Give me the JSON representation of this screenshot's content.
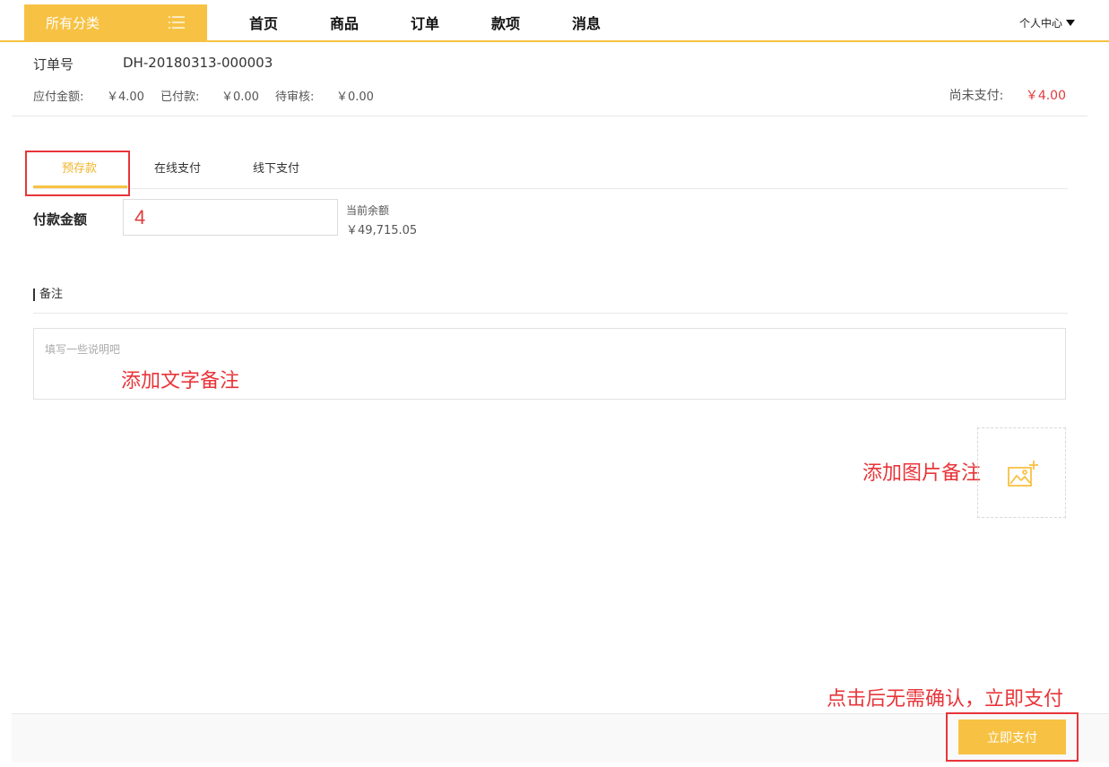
{
  "header": {
    "category_label": "所有分类",
    "nav": [
      "首页",
      "商品",
      "订单",
      "款项",
      "消息"
    ],
    "user_menu": "个人中心"
  },
  "order": {
    "no_label": "订单号",
    "no_value": "DH-20180313-000003",
    "payable_label": "应付金额:",
    "payable_value": "￥4.00",
    "paid_label": "已付款:",
    "paid_value": "￥0.00",
    "pending_label": "待审核:",
    "pending_value": "￥0.00",
    "unpaid_label": "尚未支付:",
    "unpaid_value": "￥4.00"
  },
  "tabs": [
    "预存款",
    "在线支付",
    "线下支付"
  ],
  "active_tab": 0,
  "payment": {
    "amount_label": "付款金额",
    "amount_value": "4",
    "balance_label": "当前余额",
    "balance_value": "￥49,715.05"
  },
  "remark": {
    "title": "备注",
    "placeholder": "填写一些说明吧"
  },
  "annotations": {
    "text_remark": "添加文字备注",
    "image_remark": "添加图片备注",
    "pay_note": "点击后无需确认，立即支付"
  },
  "footer": {
    "pay_button": "立即支付"
  },
  "colors": {
    "accent": "#f7c243",
    "annotation": "#e8353a",
    "price": "#e03c3c"
  }
}
